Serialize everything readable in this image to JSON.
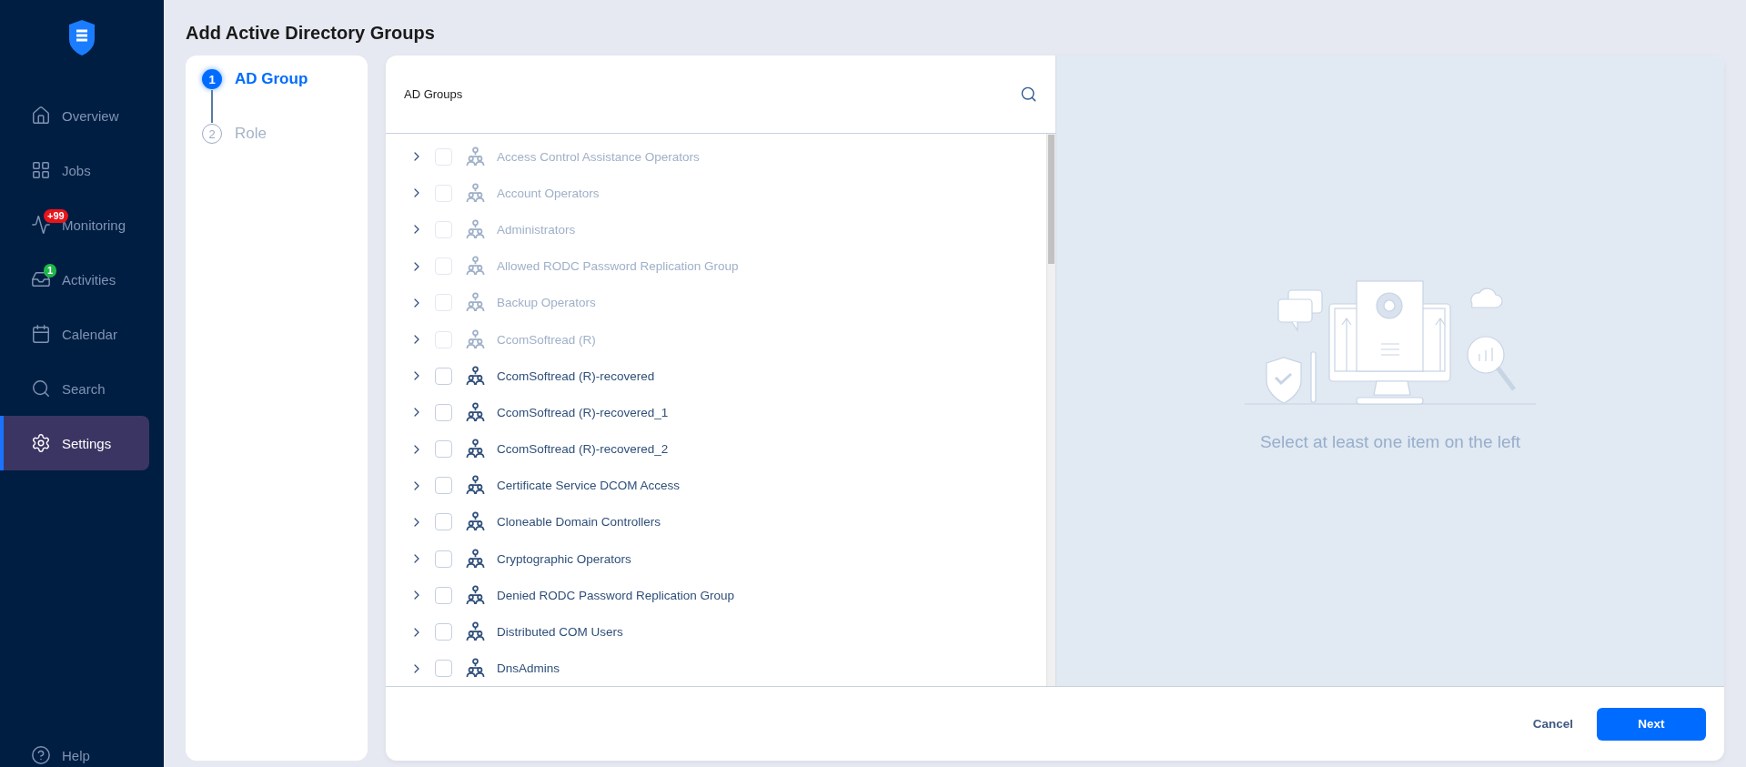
{
  "sidebar": {
    "items": [
      {
        "kind": "overview",
        "label": "Overview",
        "selected": false
      },
      {
        "kind": "jobs",
        "label": "Jobs",
        "selected": false
      },
      {
        "kind": "monitoring",
        "label": "Monitoring",
        "selected": false,
        "badge": "+99",
        "color": "#e8141b"
      },
      {
        "kind": "activities",
        "label": "Activities",
        "selected": false,
        "badge": "1",
        "color": "#1fb84a"
      },
      {
        "kind": "calendar",
        "label": "Calendar",
        "selected": false
      },
      {
        "kind": "search",
        "label": "Search",
        "selected": false
      },
      {
        "kind": "settings",
        "label": "Settings",
        "selected": true
      }
    ],
    "help": "Help"
  },
  "page_title": "Add Active Directory Groups",
  "steps": [
    {
      "number": "1",
      "label": "AD Group",
      "selected": true
    },
    {
      "number": "2",
      "label": "Role",
      "selected": false
    }
  ],
  "list": {
    "title": "AD Groups",
    "items": [
      {
        "label": "Access Control Assistance Operators",
        "disabled": true,
        "checked": false
      },
      {
        "label": "Account Operators",
        "disabled": true,
        "checked": false
      },
      {
        "label": "Administrators",
        "disabled": true,
        "checked": false
      },
      {
        "label": "Allowed RODC Password Replication Group",
        "disabled": true,
        "checked": false
      },
      {
        "label": "Backup Operators",
        "disabled": true,
        "checked": false
      },
      {
        "label": "CcomSoftread (R)",
        "disabled": true,
        "checked": false
      },
      {
        "label": "CcomSoftread (R)-recovered",
        "disabled": false,
        "checked": false
      },
      {
        "label": "CcomSoftread (R)-recovered_1",
        "disabled": false,
        "checked": false
      },
      {
        "label": "CcomSoftread (R)-recovered_2",
        "disabled": false,
        "checked": false
      },
      {
        "label": "Certificate Service DCOM Access",
        "disabled": false,
        "checked": false
      },
      {
        "label": "Cloneable Domain Controllers",
        "disabled": false,
        "checked": false
      },
      {
        "label": "Cryptographic Operators",
        "disabled": false,
        "checked": false
      },
      {
        "label": "Denied RODC Password Replication Group",
        "disabled": false,
        "checked": false
      },
      {
        "label": "Distributed COM Users",
        "disabled": false,
        "checked": false
      },
      {
        "label": "DnsAdmins",
        "disabled": false,
        "checked": false
      }
    ]
  },
  "empty_state": "Select at least one item on the left",
  "buttons": {
    "cancel": "Cancel",
    "next": "Next"
  }
}
